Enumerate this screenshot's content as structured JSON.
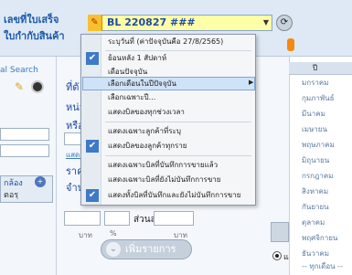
{
  "header": {
    "doc_label_line1": "เลขที่ใบเสร็จ",
    "doc_label_line2": "ใบกำกับสินค้า",
    "doc_number": "BL 220827 ###",
    "flag_glyph": "✎"
  },
  "left_panel": {
    "search_label": "al Search",
    "tab_label_1": "กล้อง",
    "tab_label_2": "ตอรฺ"
  },
  "form": {
    "label_1": "ที่ตั",
    "label_2": "หน่ว",
    "label_3": "หรือ",
    "link": "แสดง",
    "label_4": "ราคา",
    "label_5": "จำนว",
    "discount_label": "ส่วนลด",
    "unit_1": "บาท",
    "unit_2": "%",
    "unit_3": "บาท",
    "add_item_button": "เพิ่มรายการ",
    "add_item_icon": "⌄",
    "radio_label": "แยกบ"
  },
  "month_list": {
    "header": "ปี",
    "items": [
      "มกราคม",
      "กุมภาพันธ์",
      "มีนาคม",
      "เมษายน",
      "พฤษภาคม",
      "มิถุนายน",
      "กรกฎาคม",
      "สิงหาคม",
      "กันยายน",
      "ตุลาคม",
      "พฤศจิกายน",
      "ธันวาคม",
      "-- ทุกเดือน --"
    ]
  },
  "popup_menu": {
    "items": [
      {
        "label": "ระบุวันที่ (ค่าปัจจุบันคือ 27/8/2565)",
        "checked": false
      },
      {
        "label": "ย้อนหลัง 1 สัปดาห์",
        "checked": true
      },
      {
        "label": "เดือนปัจจุบัน",
        "checked": false
      },
      {
        "label": "เลือกเดือนในปีปัจจุบัน",
        "checked": false,
        "highlighted": true,
        "submenu": true
      },
      {
        "label": "เลือกเฉพาะปี...",
        "checked": false
      },
      {
        "label": "แสดงบิลของทุกช่วงเวลา",
        "checked": false
      },
      {
        "label": "แสดงเฉพาะลูกค้าที่ระบุ",
        "checked": false
      },
      {
        "label": "แสดงบิลของลูกค้าทุกราย",
        "checked": true
      },
      {
        "label": "แสดงเฉพาะบิลที่บันทึกการขายแล้ว",
        "checked": false
      },
      {
        "label": "แสดงเฉพาะบิลที่ยังไม่บันทึกการขาย",
        "checked": false
      },
      {
        "label": "แสดงทั้งบิลที่บันทึกและยังไม่บันทึกการขาย",
        "checked": true
      }
    ]
  },
  "colors": {
    "accent": "#3e79c6",
    "highlight": "#cfe3f8",
    "doc_field": "#ffffa8"
  }
}
